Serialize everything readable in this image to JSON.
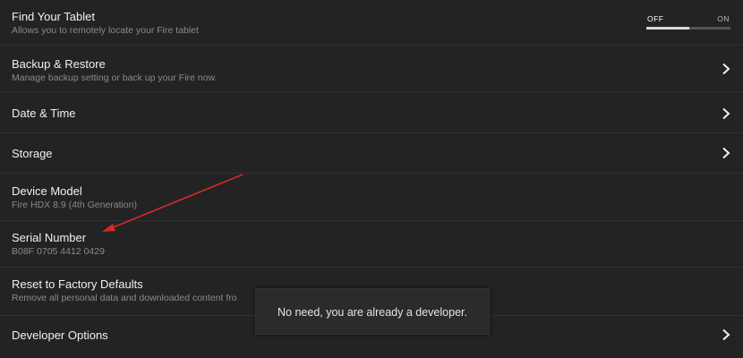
{
  "settings": {
    "find_tablet": {
      "title": "Find Your Tablet",
      "subtitle": "Allows you to remotely locate your Fire tablet",
      "toggle": {
        "off_label": "OFF",
        "on_label": "ON",
        "state": "off"
      }
    },
    "backup": {
      "title": "Backup & Restore",
      "subtitle": "Manage backup setting or back up your Fire now."
    },
    "date_time": {
      "title": "Date & Time"
    },
    "storage": {
      "title": "Storage"
    },
    "device_model": {
      "title": "Device Model",
      "value": "Fire HDX 8.9 (4th Generation)"
    },
    "serial_number": {
      "title": "Serial Number",
      "value": "B08F 0705 4412 0429"
    },
    "reset": {
      "title": "Reset to Factory Defaults",
      "subtitle": "Remove all personal data and downloaded content fro"
    },
    "developer": {
      "title": "Developer Options"
    }
  },
  "toast": {
    "message": "No need, you are already a developer."
  },
  "annotation": {
    "icon": "red-arrow-icon",
    "color": "#d42a2a"
  },
  "colors": {
    "background": "#232323",
    "divider": "#303030",
    "text_primary": "#f1f1f1",
    "text_secondary": "#8a8a8a"
  }
}
